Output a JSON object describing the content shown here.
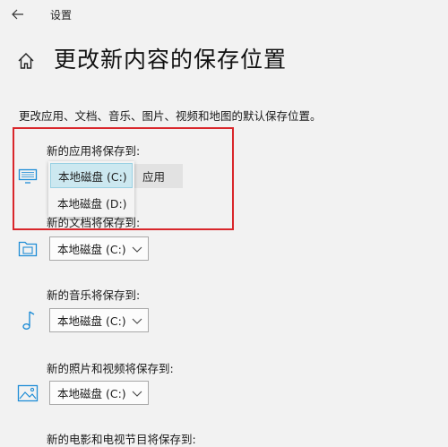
{
  "window": {
    "title": "设置"
  },
  "header": {
    "title": "更改新内容的保存位置"
  },
  "description": "更改应用、文档、音乐、图片、视频和地图的默认保存位置。",
  "sections": [
    {
      "label": "新的应用将保存到:",
      "value": "本地磁盘 (C:)",
      "apply_label": "应用",
      "icon": "monitor-icon"
    },
    {
      "label": "新的文档将保存到:",
      "value": "本地磁盘 (C:)",
      "icon": "folder-icon"
    },
    {
      "label": "新的音乐将保存到:",
      "value": "本地磁盘 (C:)",
      "icon": "music-note-icon"
    },
    {
      "label": "新的照片和视频将保存到:",
      "value": "本地磁盘 (C:)",
      "icon": "image-icon"
    },
    {
      "label": "新的电影和电视节目将保存到:",
      "icon": "tv-icon"
    }
  ],
  "dropdown": {
    "options": [
      "本地磁盘 (C:)",
      "本地磁盘 (D:)"
    ],
    "selected_index": 0
  },
  "colors": {
    "accent": "#1f8dd6",
    "highlight": "#cce8f0",
    "annotation": "#d9262b"
  }
}
